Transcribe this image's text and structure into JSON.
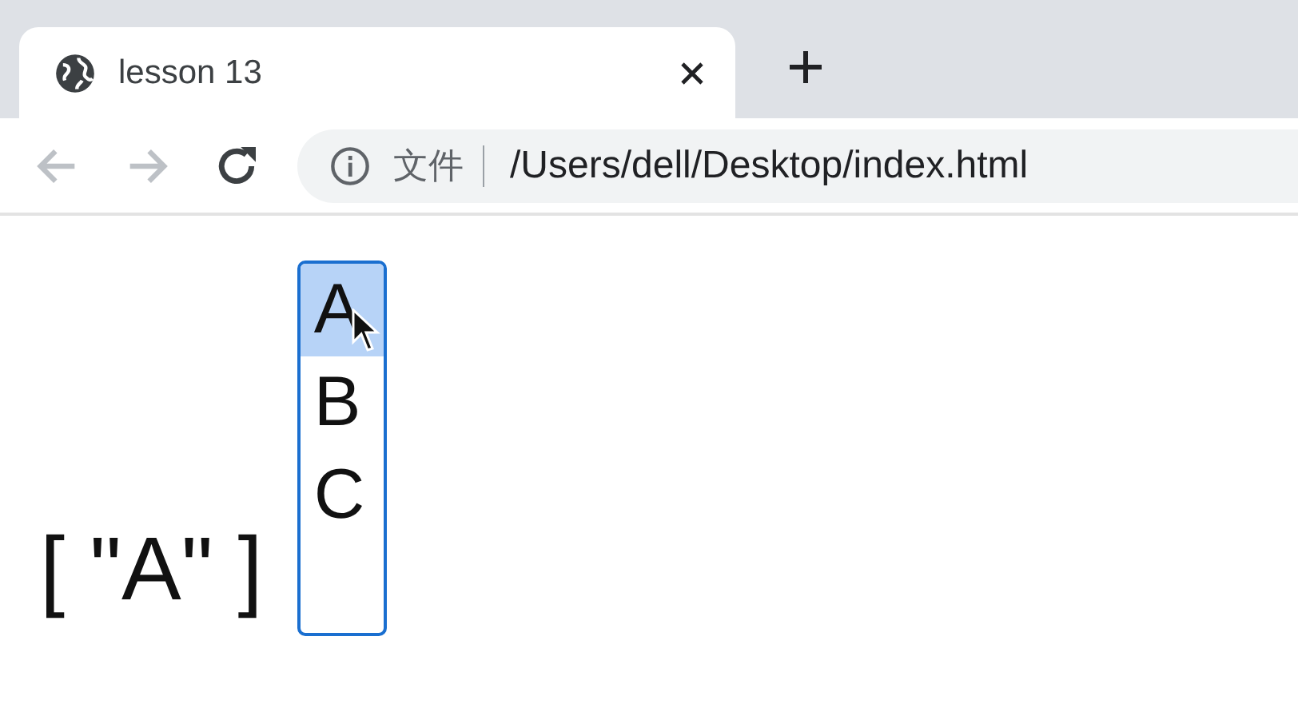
{
  "tab": {
    "title": "lesson 13",
    "selected": true
  },
  "navigation": [
    {
      "kind": "back",
      "disabled": true
    },
    {
      "kind": "forward",
      "disabled": true
    },
    {
      "kind": "reload",
      "disabled": false
    }
  ],
  "address_bar": {
    "security_label": "文件",
    "url": "/Users/dell/Desktop/index.html"
  },
  "page": {
    "output": "[ \"A\" ]",
    "listbox": {
      "options": [
        {
          "label": "A",
          "selected": true
        },
        {
          "label": "B",
          "selected": false
        },
        {
          "label": "C",
          "selected": false
        }
      ]
    }
  }
}
